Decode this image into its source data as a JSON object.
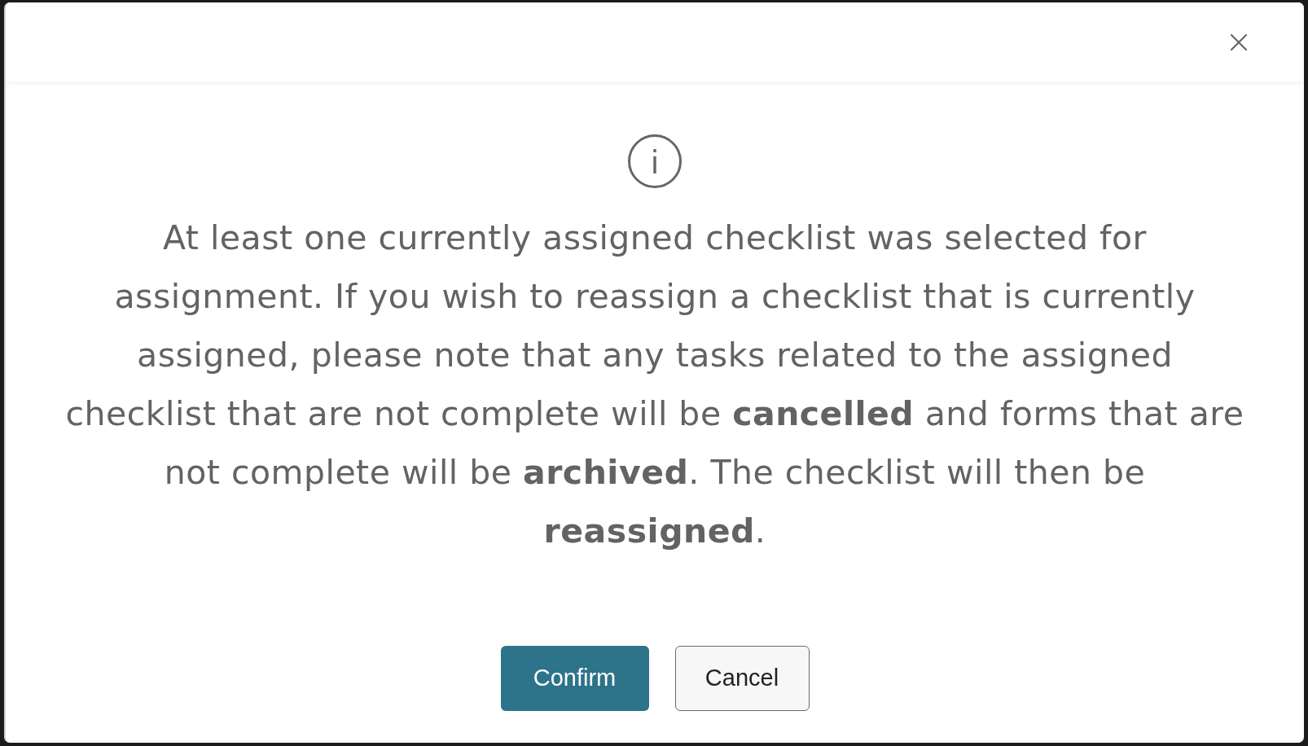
{
  "dialog": {
    "message": "At least one currently assigned checklist was selected for assignment. If you wish to reassign a checklist that is currently assigned, please note that any tasks related to the assigned checklist that are not complete will be **cancelled** and forms that are not complete will be **archived**. The checklist will then be **reassigned**.",
    "buttons": [
      {
        "label": "Confirm",
        "kind": "primary"
      },
      {
        "label": "Cancel",
        "kind": "secondary"
      }
    ]
  }
}
